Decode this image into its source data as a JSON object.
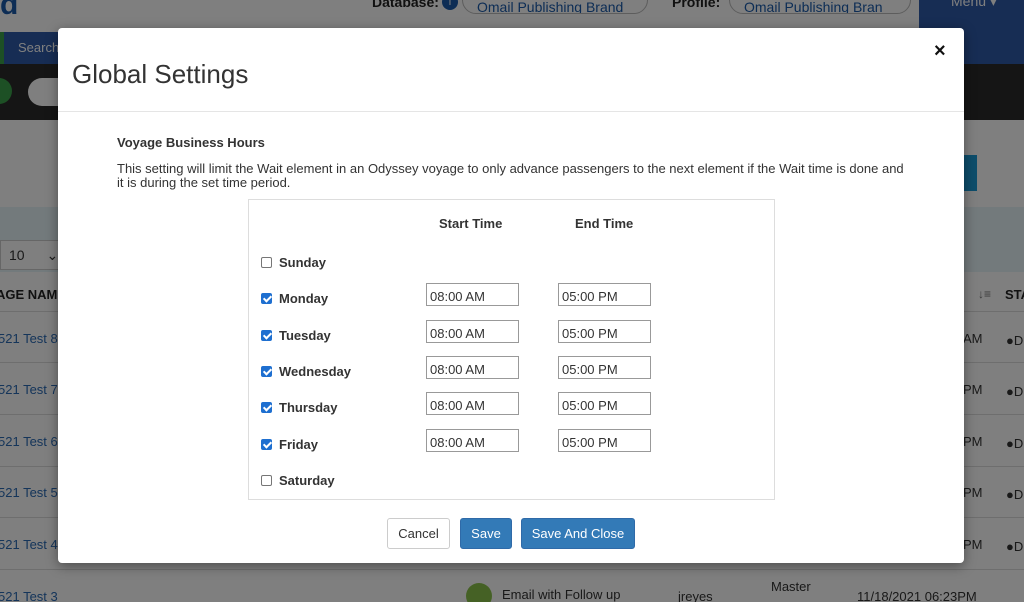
{
  "background": {
    "logo": "d",
    "database_label": "Database:",
    "database_value": "Omail Publishing Brand",
    "profile_label": "Profile:",
    "profile_value": "Omail Publishing Bran",
    "menu_label": "Menu",
    "nav_search": "Search",
    "page_size": "10",
    "col_name_header": "AGE NAME",
    "col_status_header": "STA",
    "rows": [
      {
        "name": "521 Test 8",
        "time": "AM",
        "status": "●D"
      },
      {
        "name": "521 Test 7",
        "time": "PM",
        "status": "●D"
      },
      {
        "name": "521 Test 6",
        "time": "PM",
        "status": "●D"
      },
      {
        "name": "521 Test 5",
        "time": "PM",
        "status": "●D"
      },
      {
        "name": "521 Test 4",
        "time": "PM",
        "status": "●D"
      },
      {
        "name": "521 Test 3"
      }
    ],
    "last_row": {
      "email_type": "Email with Follow up",
      "owner": "jreyes",
      "master": "Master",
      "date": "11/18/2021 06:23PM"
    }
  },
  "modal": {
    "title": "Global Settings",
    "close_icon": "×",
    "section_title": "Voyage Business Hours",
    "section_desc": "This setting will limit the Wait element in an Odyssey voyage to only advance passengers to the next element if the Wait time is done and it is during the set time period.",
    "start_time_header": "Start Time",
    "end_time_header": "End Time",
    "days": [
      {
        "label": "Sunday",
        "checked": false,
        "start": "",
        "end": ""
      },
      {
        "label": "Monday",
        "checked": true,
        "start": "08:00 AM",
        "end": "05:00 PM"
      },
      {
        "label": "Tuesday",
        "checked": true,
        "start": "08:00 AM",
        "end": "05:00 PM"
      },
      {
        "label": "Wednesday",
        "checked": true,
        "start": "08:00 AM",
        "end": "05:00 PM"
      },
      {
        "label": "Thursday",
        "checked": true,
        "start": "08:00 AM",
        "end": "05:00 PM"
      },
      {
        "label": "Friday",
        "checked": true,
        "start": "08:00 AM",
        "end": "05:00 PM"
      },
      {
        "label": "Saturday",
        "checked": false,
        "start": "",
        "end": ""
      }
    ],
    "buttons": {
      "cancel": "Cancel",
      "save": "Save",
      "save_close": "Save And Close"
    }
  },
  "colors": {
    "primary_button": "#337ab7",
    "nav_blue": "#2e5aa8",
    "checkbox_blue": "#1e6fd0"
  }
}
